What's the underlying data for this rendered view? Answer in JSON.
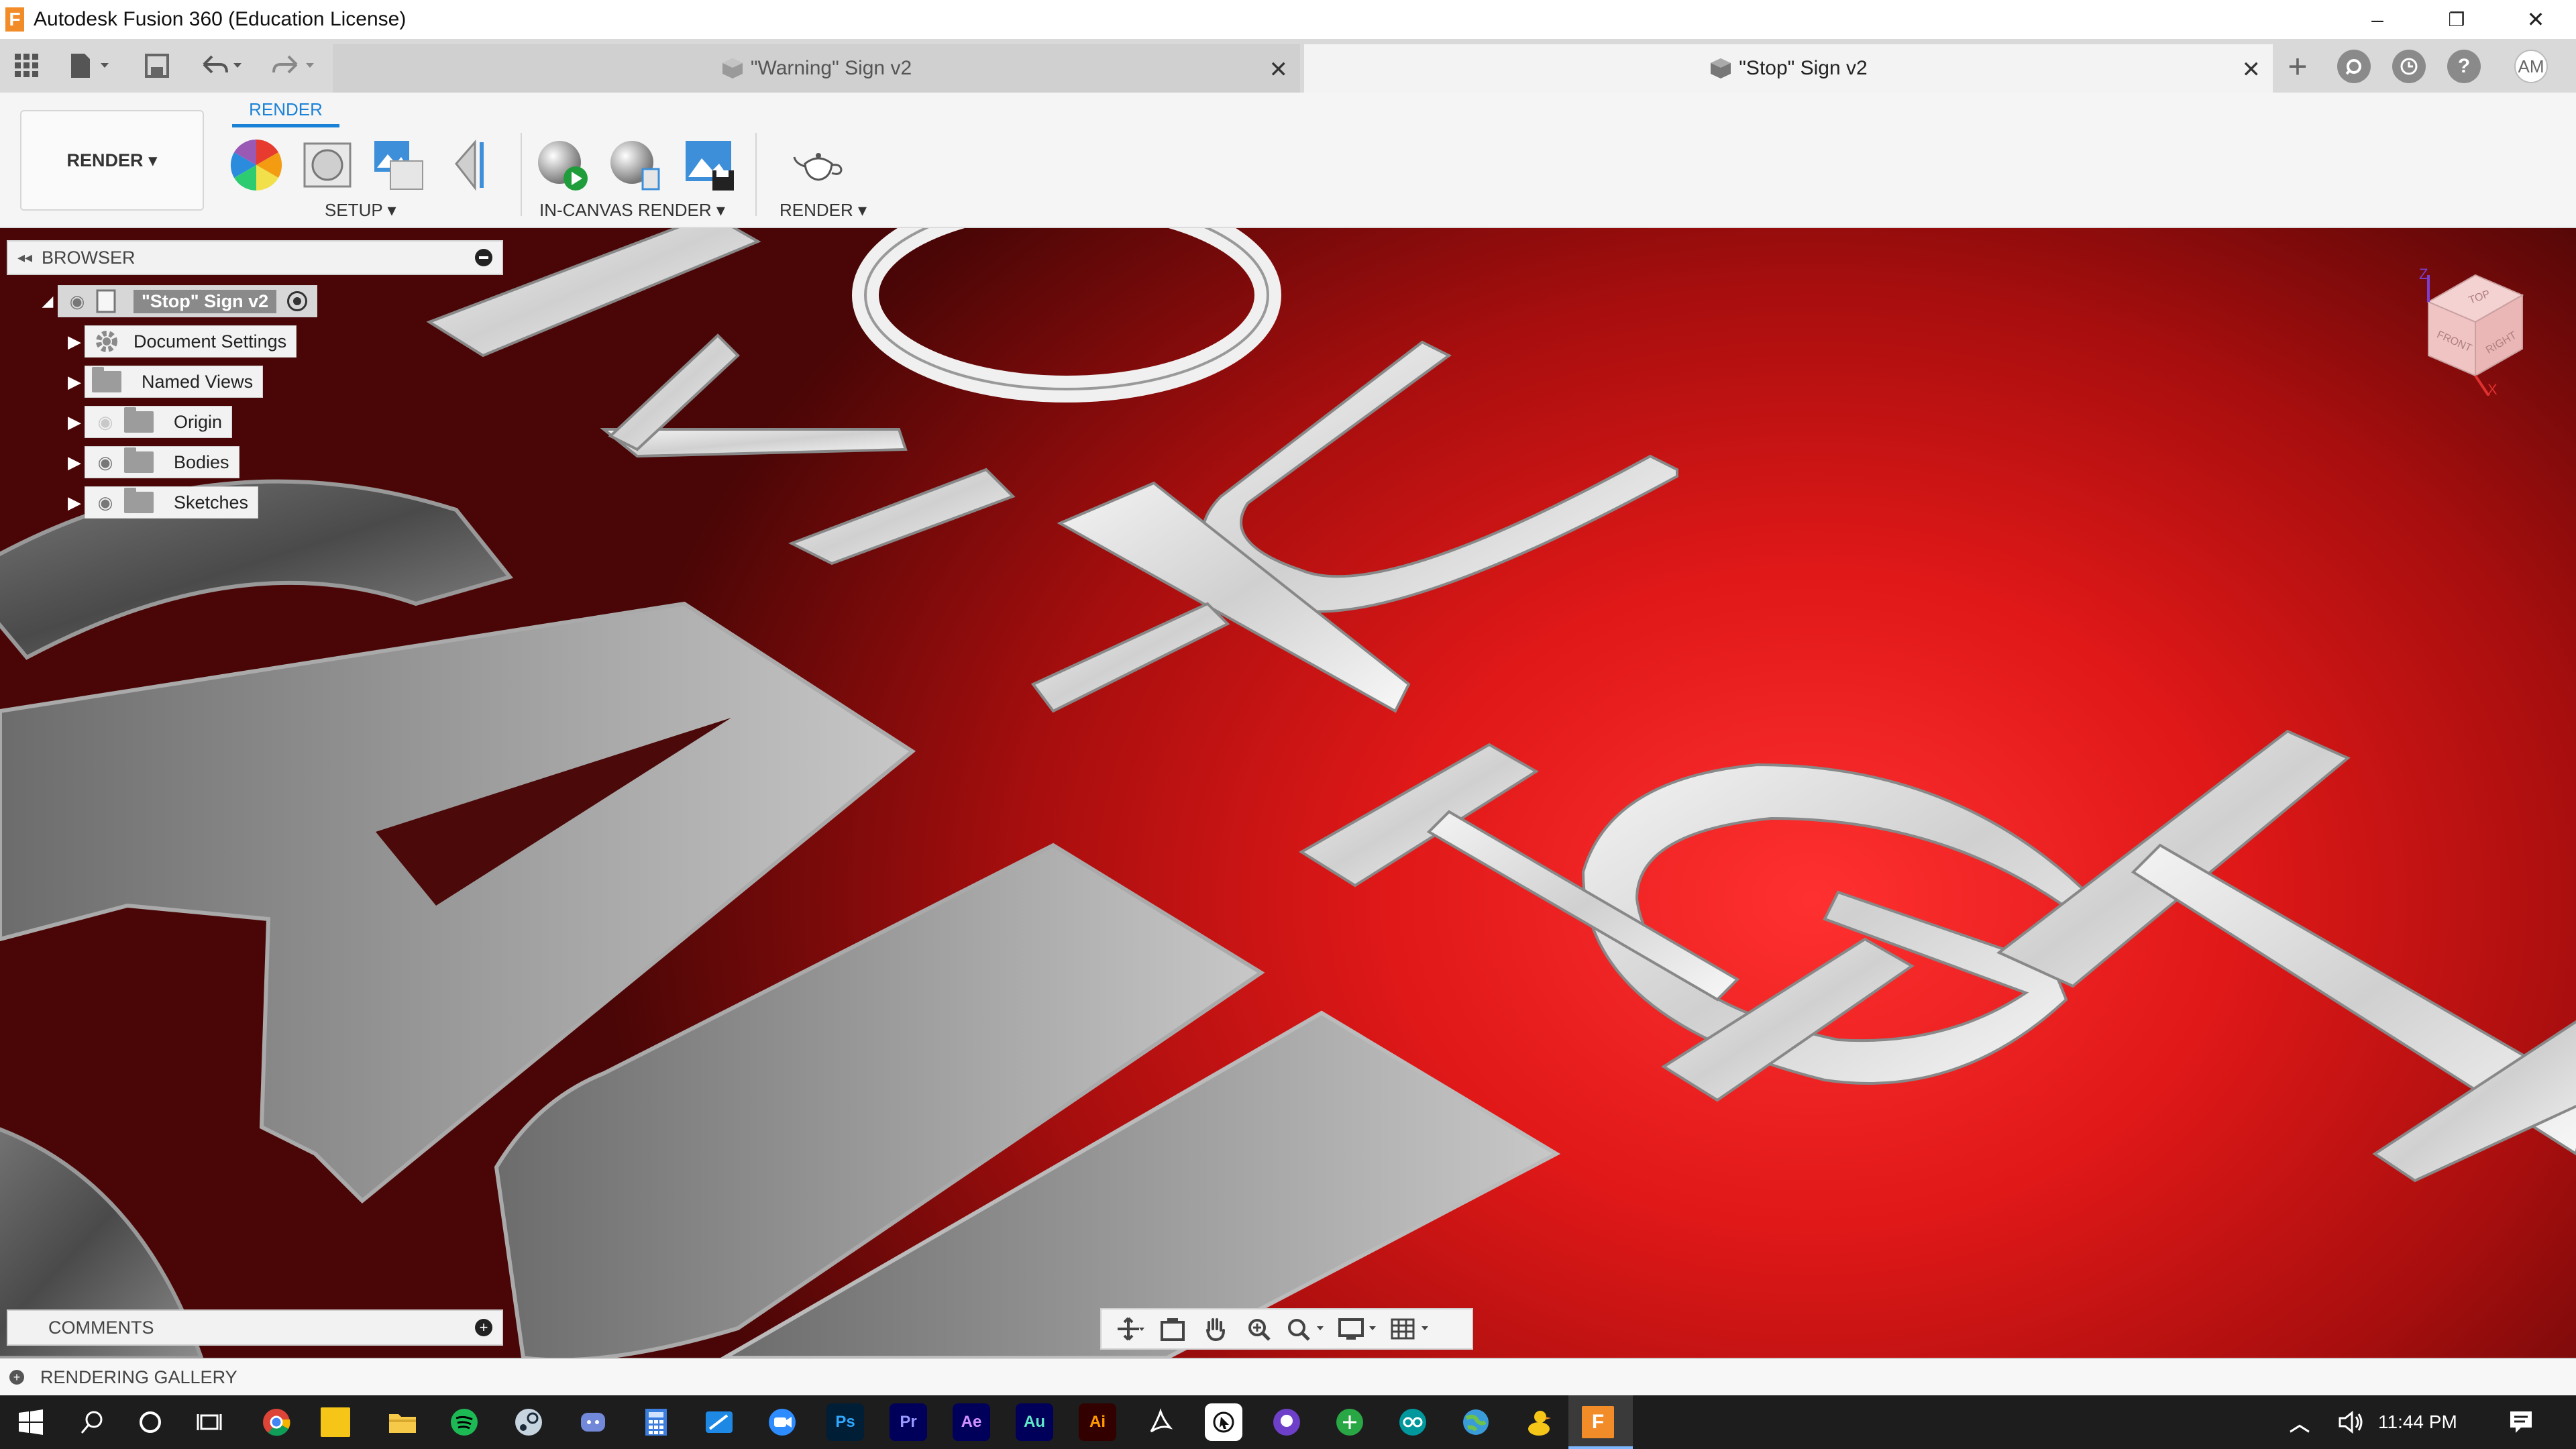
{
  "window": {
    "title": "Autodesk Fusion 360 (Education License)",
    "logo_letter": "F",
    "minimize_glyph": "–",
    "restore_glyph": "❐",
    "close_glyph": "✕"
  },
  "tabs": [
    {
      "label": "\"Warning\" Sign v2",
      "active": false,
      "close_glyph": "✕"
    },
    {
      "label": "\"Stop\" Sign v2",
      "active": true,
      "close_glyph": "✕"
    }
  ],
  "topright": {
    "avatar_initials": "AM",
    "add_glyph": "+",
    "help_glyph": "?"
  },
  "toolbar": {
    "workspace_label": "RENDER ▾",
    "active_tab": "RENDER",
    "groups": [
      {
        "label": "SETUP ▾"
      },
      {
        "label": "IN-CANVAS RENDER ▾"
      },
      {
        "label": "RENDER ▾"
      }
    ]
  },
  "browser": {
    "header_label": "BROWSER",
    "collapse_glyph": "◂◂",
    "root_label": "\"Stop\" Sign v2",
    "items": [
      {
        "label": "Document Settings",
        "icon": "gear-icon",
        "visible_toggle": false
      },
      {
        "label": "Named Views",
        "icon": "folder-icon",
        "visible_toggle": false
      },
      {
        "label": "Origin",
        "icon": "folder-icon",
        "visible_toggle": true,
        "hidden": true
      },
      {
        "label": "Bodies",
        "icon": "folder-icon",
        "visible_toggle": true,
        "hidden": false
      },
      {
        "label": "Sketches",
        "icon": "folder-icon",
        "visible_toggle": true,
        "hidden": false
      }
    ]
  },
  "viewcube": {
    "top": "TOP",
    "front": "FRONT",
    "right": "RIGHT",
    "axis_z": "Z",
    "axis_x": "X"
  },
  "comments": {
    "label": "COMMENTS"
  },
  "gallery": {
    "label": "RENDERING GALLERY"
  },
  "taskbar": {
    "time": "11:44 PM",
    "apps": [
      "Ps",
      "Pr",
      "Ae",
      "Au",
      "Ai"
    ]
  },
  "colors": {
    "accent": "#1a82d6",
    "viewport_red": "#e01818",
    "fusion_orange": "#f28c28"
  }
}
